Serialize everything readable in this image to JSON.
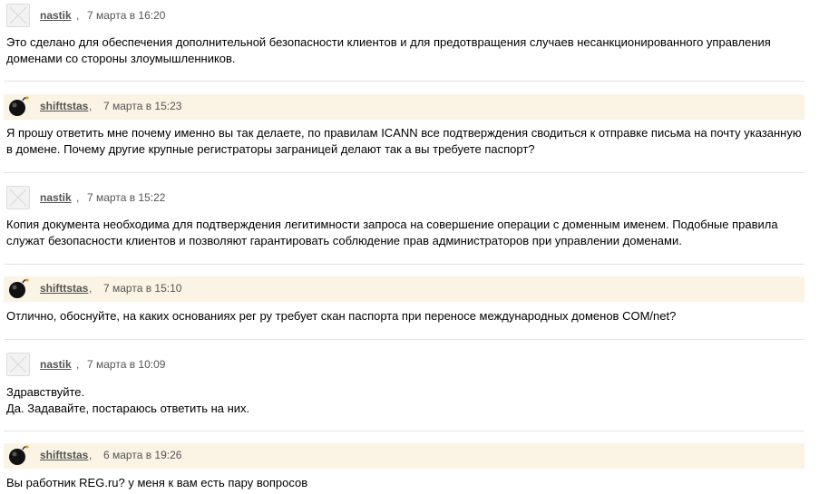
{
  "comments": [
    {
      "author": "nastik",
      "avatar": "default-avatar",
      "time": "7 марта в 16:20",
      "highlight": false,
      "text": [
        "Это сделано для обеспечения дополнительной безопасности клиентов и для предотвращения случаев несанкционированного управления",
        "доменами со стороны злоумышленников."
      ]
    },
    {
      "author": "shifttstas",
      "avatar": "bomb-avatar",
      "time": "7 марта в 15:23",
      "highlight": true,
      "text": [
        "Я прошу ответить мне почему именно вы так делаете, по правилам ICANN все подтверждения сводиться к отправке письма на почту указанную",
        "в домене. Почему другие крупные регистраторы заграницей делают так а вы требуете паспорт?"
      ]
    },
    {
      "author": "nastik",
      "avatar": "default-avatar",
      "time": "7 марта в 15:22",
      "highlight": false,
      "text": [
        "Копия документа необходима для подтверждения легитимности запроса на совершение операции с доменным именем. Подобные правила",
        "служат безопасности клиентов и позволяют гарантировать соблюдение прав администраторов при управлении доменами."
      ]
    },
    {
      "author": "shifttstas",
      "avatar": "bomb-avatar",
      "time": "7 марта в 15:10",
      "highlight": true,
      "text": [
        "Отлично, обоснуйте, на каких основаниях рег ру требует скан паспорта при переносе международных доменов COM/net?"
      ]
    },
    {
      "author": "nastik",
      "avatar": "default-avatar",
      "time": "7 марта в 10:09",
      "highlight": false,
      "text": [
        "Здравствуйте.",
        "Да. Задавайте, постараюсь ответить на них."
      ]
    },
    {
      "author": "shifttstas",
      "avatar": "bomb-avatar",
      "time": "6 марта в 19:26",
      "highlight": true,
      "text": [
        "Вы работник REG.ru? у меня к вам есть пару вопросов"
      ]
    }
  ],
  "comma": ","
}
